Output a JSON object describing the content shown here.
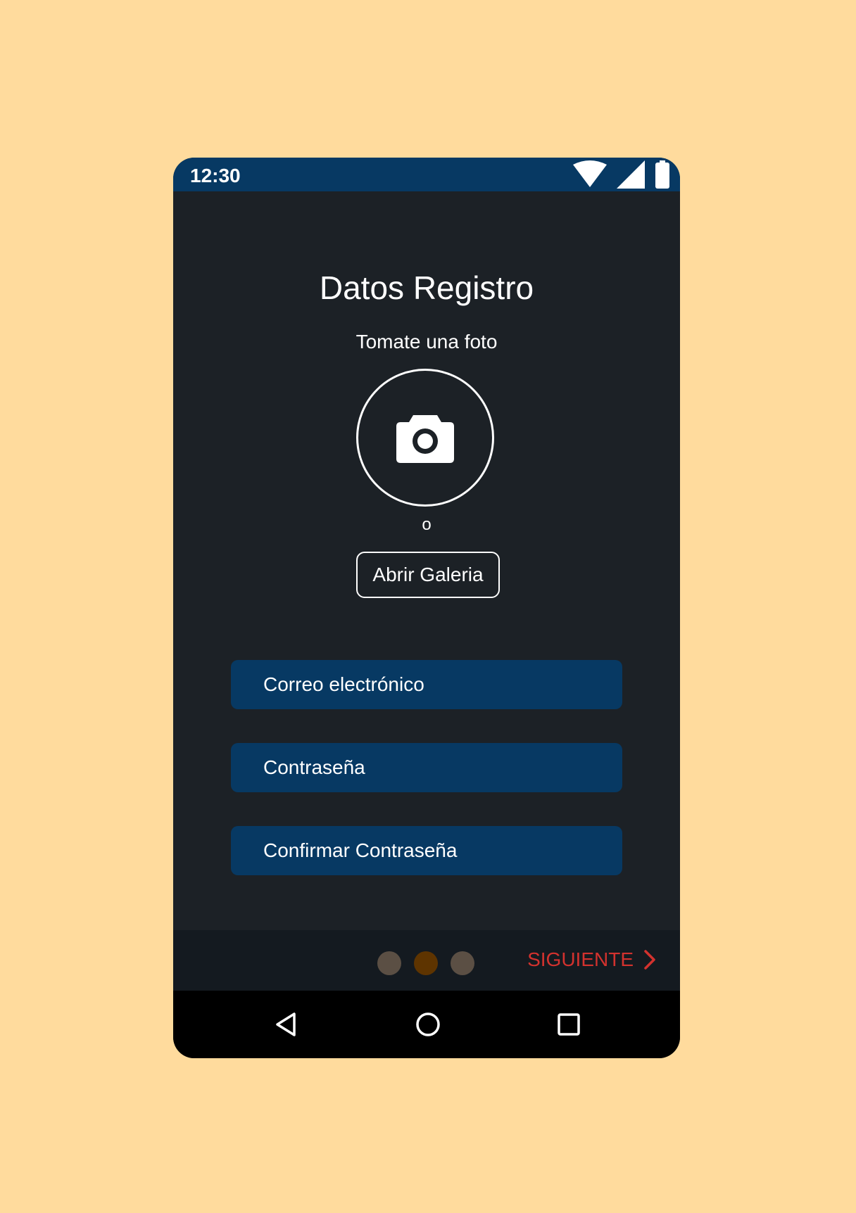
{
  "colors": {
    "background": "#FFDB9D",
    "screen": "#1C2126",
    "primary": "#073963",
    "pager_bar": "#141A20",
    "accent_next": "#D3322E",
    "dot_active": "#5E3400",
    "dot_inactive": "#5B4F44"
  },
  "status_bar": {
    "time": "12:30",
    "icons": [
      "wifi-icon",
      "signal-icon",
      "battery-icon"
    ]
  },
  "screen": {
    "title": "Datos Registro",
    "photo_prompt": "Tomate una foto",
    "camera_icon": "camera-icon",
    "or_text": "o",
    "gallery_button": "Abrir Galeria"
  },
  "form": {
    "email_placeholder": "Correo electrónico",
    "password_placeholder": "Contraseña",
    "confirm_password_placeholder": "Confirmar Contraseña"
  },
  "pager": {
    "total_pages": 3,
    "active_page": 2,
    "next_label": "SIGUIENTE",
    "next_icon": "chevron-right-icon"
  },
  "nav_bar": {
    "icons": [
      "back-icon",
      "home-icon",
      "recents-icon"
    ]
  }
}
